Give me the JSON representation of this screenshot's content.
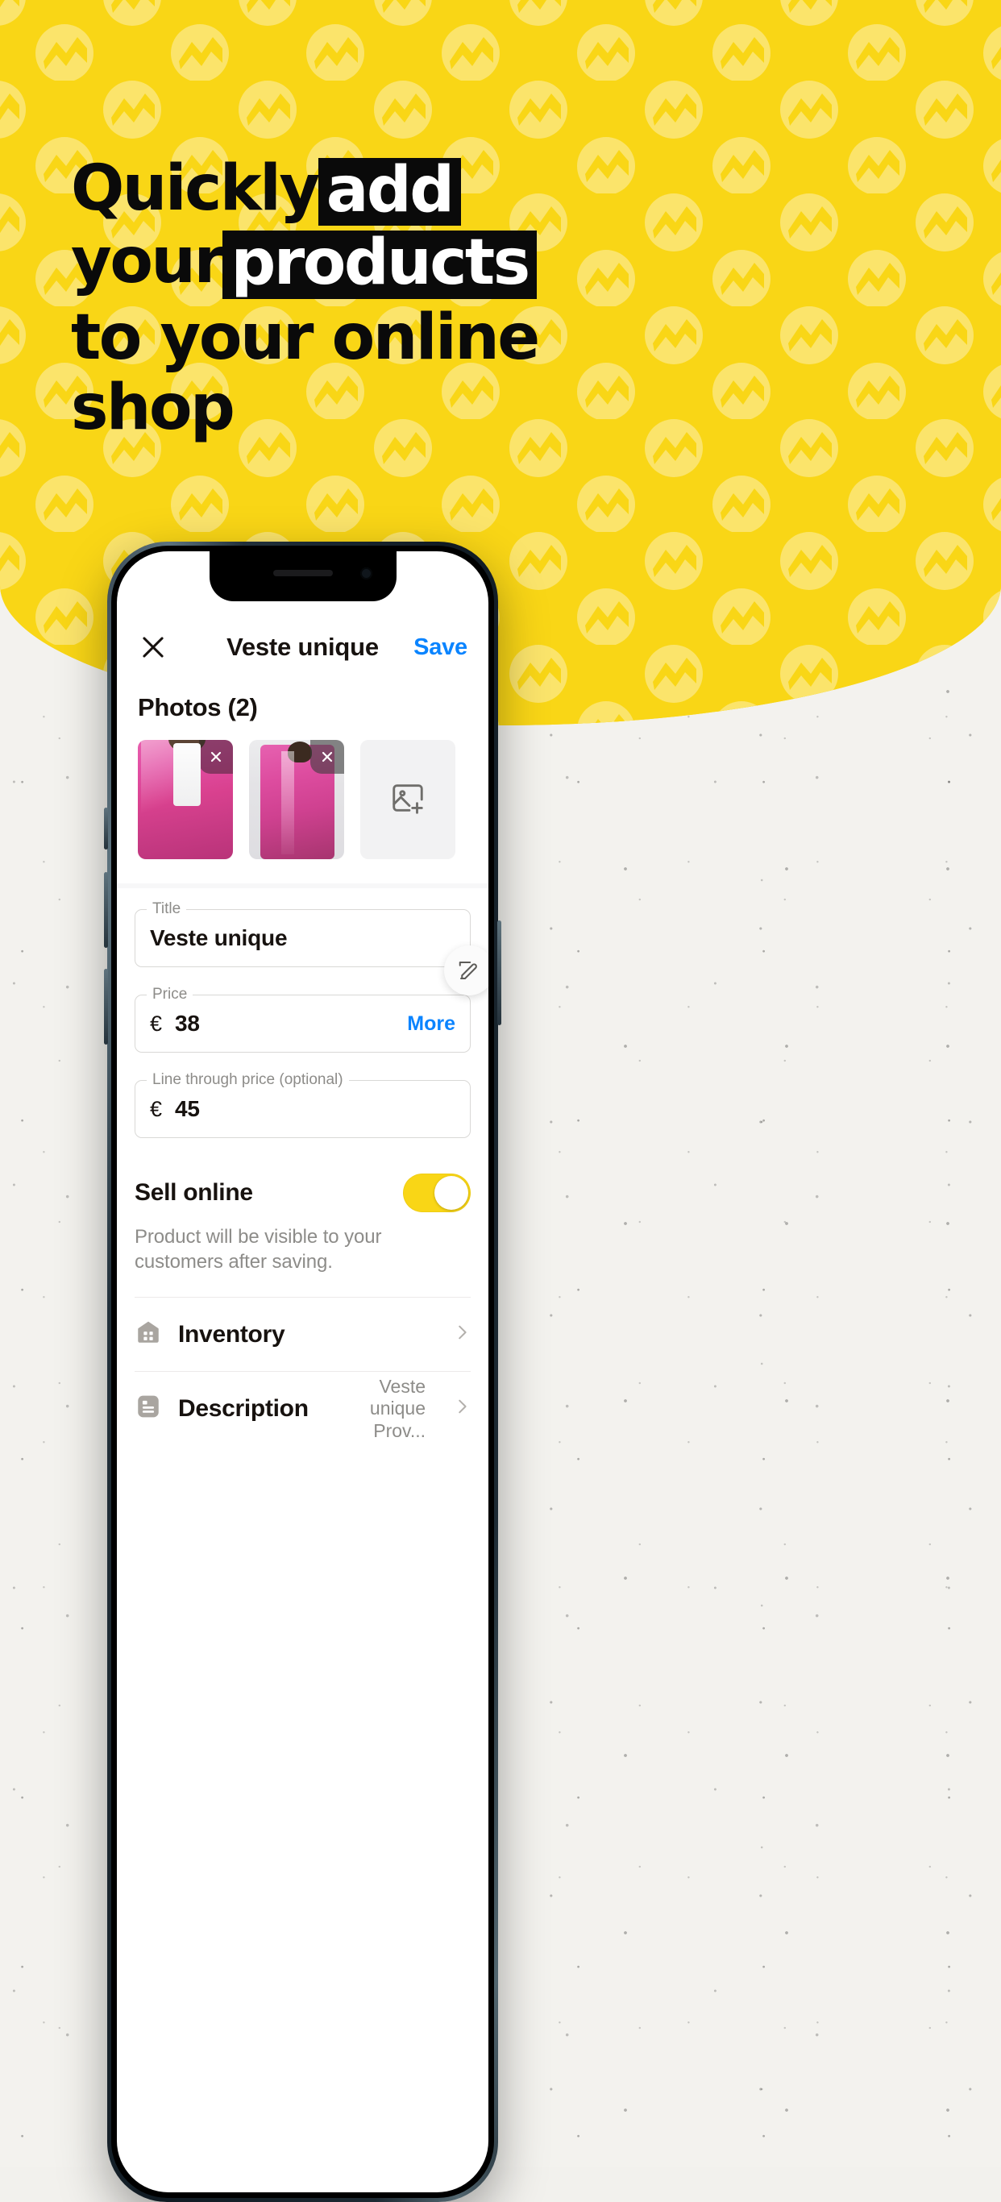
{
  "hero": {
    "headline_lines": [
      {
        "text": "Quickly",
        "highlight": false
      },
      {
        "text": "add",
        "highlight": true
      },
      {
        "text": "your",
        "highlight": false
      },
      {
        "text": "products",
        "highlight": true
      },
      {
        "text": "to your online",
        "highlight": false
      },
      {
        "text": "shop",
        "highlight": false
      }
    ],
    "brand_yellow": "#F9D616",
    "headline_text_color": "#0A0A0A",
    "highlight_bg": "#0A0A0A",
    "highlight_text": "#FFFFFF",
    "pattern_icon": "zigzag-circle-logo"
  },
  "app": {
    "navbar": {
      "close_icon": "close-icon",
      "title": "Veste unique",
      "save_label": "Save",
      "save_color": "#0A84FF"
    },
    "photos": {
      "heading": "Photos (2)",
      "count": 2,
      "items": [
        {
          "alt": "pink jacket front",
          "remove_icon": "close-icon"
        },
        {
          "alt": "pink jacket full",
          "remove_icon": "close-icon"
        }
      ],
      "add_tile_icon": "add-image-icon"
    },
    "form": {
      "title_field": {
        "label": "Title",
        "value": "Veste unique"
      },
      "price_field": {
        "label": "Price",
        "currency": "€",
        "value": "38",
        "more_label": "More"
      },
      "line_through_field": {
        "label": "Line through price (optional)",
        "currency": "€",
        "value": "45"
      },
      "edit_icon": "edit-square-icon"
    },
    "sell_online": {
      "label": "Sell online",
      "enabled": true,
      "toggle_color": "#F9D616",
      "description": "Product will be visible to your customers after saving."
    },
    "list": [
      {
        "icon": "warehouse-icon",
        "label": "Inventory",
        "value": "",
        "chevron": "chevron-right-icon"
      },
      {
        "icon": "description-icon",
        "label": "Description",
        "value": "Veste unique Prov...",
        "chevron": "chevron-right-icon"
      }
    ]
  }
}
